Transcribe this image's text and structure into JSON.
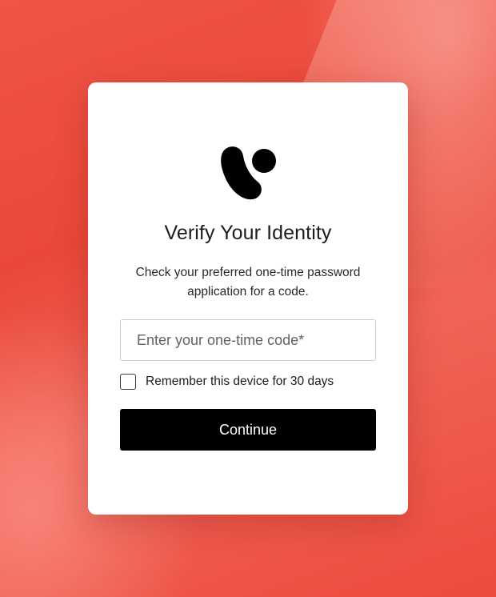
{
  "card": {
    "title": "Verify Your Identity",
    "subtitle": "Check your preferred one-time password application for a code.",
    "code_input": {
      "placeholder": "Enter your one-time code*",
      "value": ""
    },
    "remember": {
      "label": "Remember this device for 30 days",
      "checked": false
    },
    "continue_label": "Continue"
  },
  "icons": {
    "logo": "brand-logo-icon"
  },
  "colors": {
    "background": "#ec4e40",
    "card": "#ffffff",
    "button": "#000000",
    "button_text": "#ffffff"
  }
}
